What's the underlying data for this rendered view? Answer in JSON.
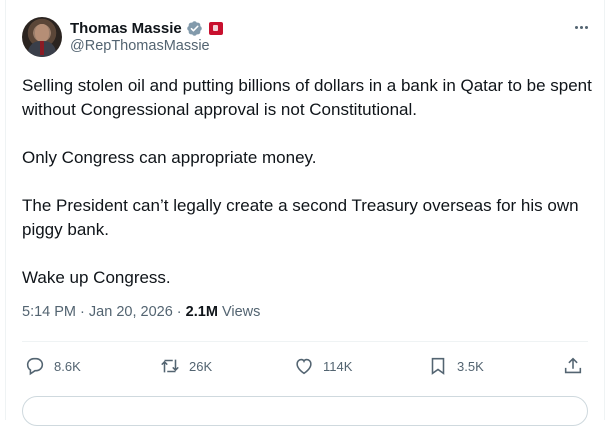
{
  "author": {
    "display_name": "Thomas Massie",
    "handle": "@RepThomasMassie",
    "verified": true,
    "affiliation_badge_color": "#c8102e"
  },
  "tweet": {
    "paragraphs": [
      "Selling stolen oil and putting billions of dollars in a bank in Qatar to be spent without Congressional approval is not Constitutional.",
      "Only Congress can appropriate money.",
      "The President can’t legally create a second Treasury overseas for his own piggy bank.",
      "Wake up Congress."
    ],
    "time": "5:14 PM",
    "date": "Jan 20, 2026",
    "separator": "·",
    "views_count": "2.1M",
    "views_label": "Views"
  },
  "actions": {
    "replies": "8.6K",
    "reposts": "26K",
    "likes": "114K",
    "bookmarks": "3.5K"
  },
  "icons": [
    "verified-icon",
    "more-icon",
    "reply-icon",
    "repost-icon",
    "like-icon",
    "bookmark-icon",
    "share-icon"
  ],
  "colors": {
    "text_primary": "#0f1419",
    "text_secondary": "#536471",
    "verified": "#829aab",
    "border": "#eff3f4"
  }
}
